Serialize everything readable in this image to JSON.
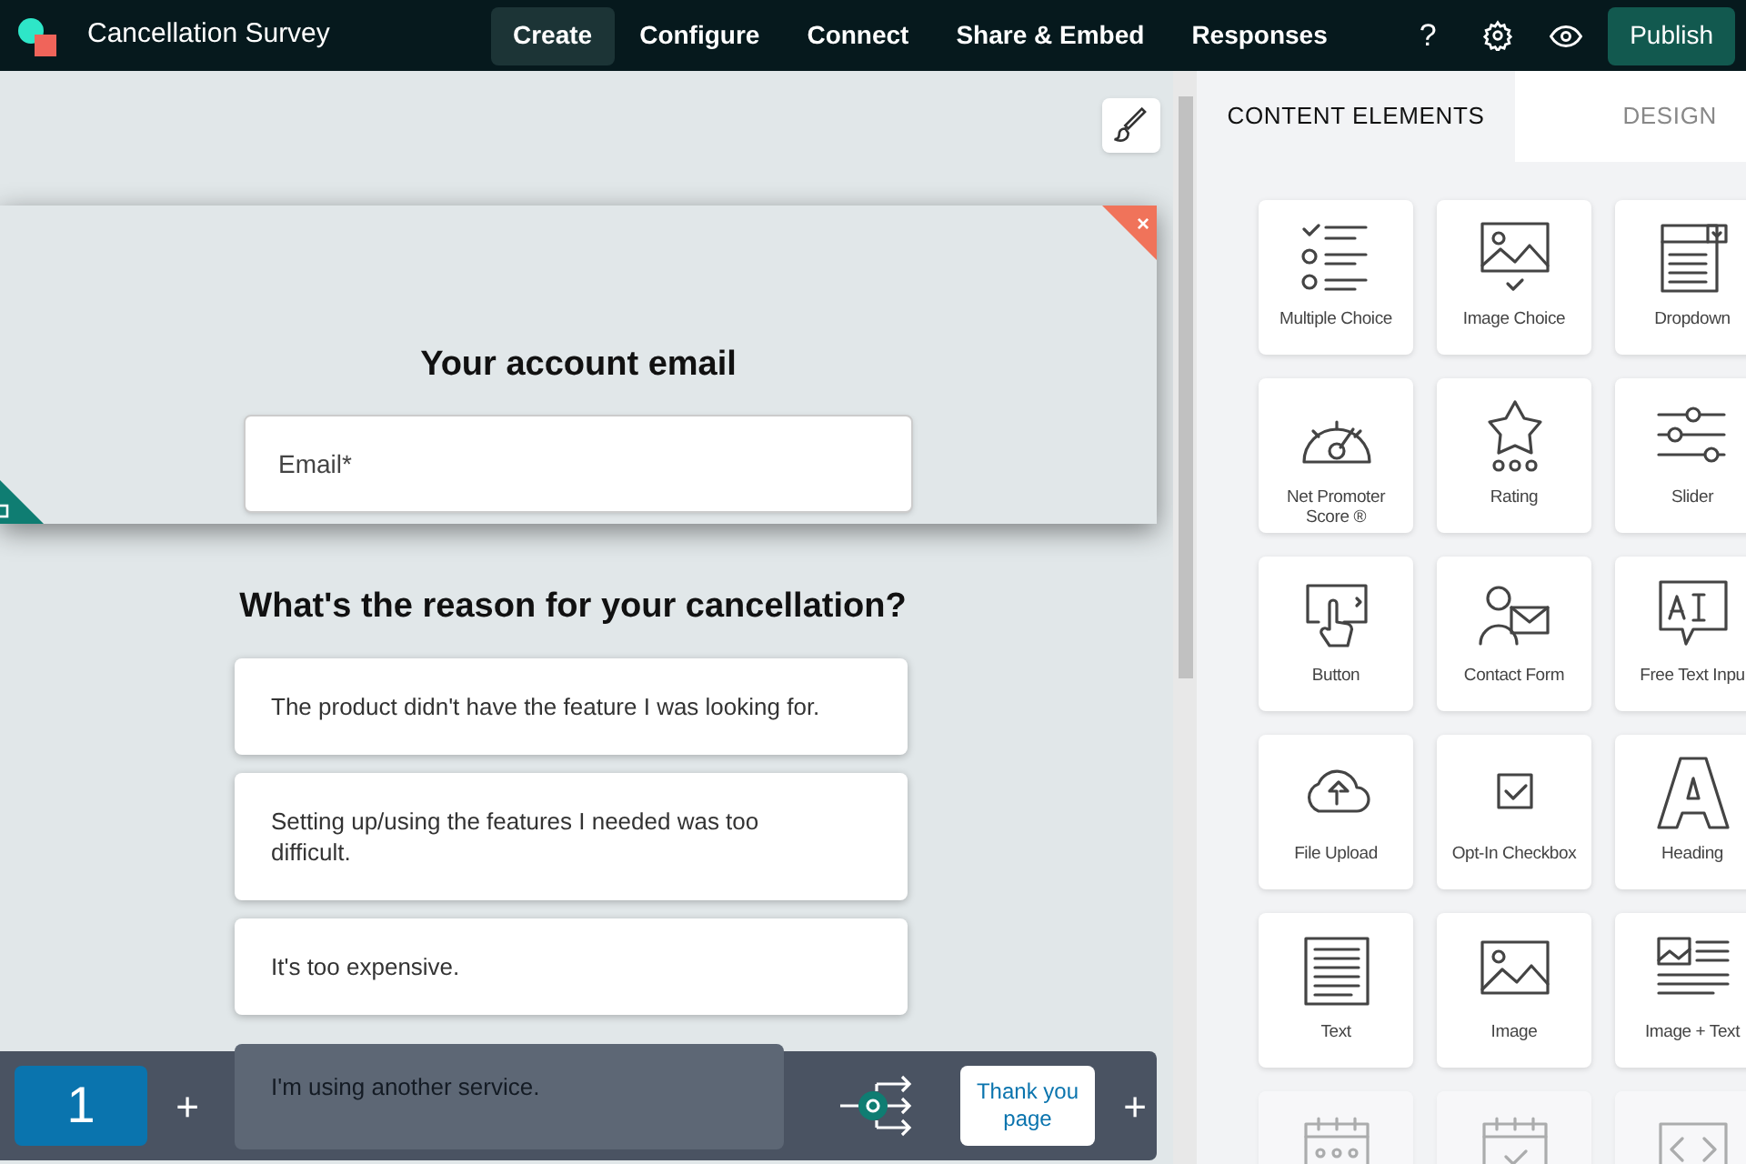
{
  "app": {
    "title": "Cancellation Survey"
  },
  "nav": [
    {
      "label": "Create",
      "selected": true
    },
    {
      "label": "Configure",
      "selected": false
    },
    {
      "label": "Connect",
      "selected": false
    },
    {
      "label": "Share & Embed",
      "selected": false
    },
    {
      "label": "Responses",
      "selected": false
    }
  ],
  "toolbar": {
    "help": "?",
    "publish": "Publish"
  },
  "canvas": {
    "close": "×",
    "email_heading": "Your account email",
    "email_placeholder": "Email*",
    "question": "What's the reason for your cancellation?",
    "options": [
      "The product didn't have the feature I was looking for.",
      "Setting up/using the features I needed was too difficult.",
      "It's too expensive.",
      "I'm using another service."
    ]
  },
  "pages": {
    "items": [
      {
        "label": "1",
        "selected": true
      }
    ],
    "add": "+",
    "thank_you": "Thank you page",
    "add_after": "+"
  },
  "panel": {
    "tabs": [
      {
        "label": "CONTENT ELEMENTS",
        "selected": true
      },
      {
        "label": "DESIGN",
        "selected": false
      }
    ],
    "elements": [
      {
        "kind": "choice",
        "label": "Multiple Choice"
      },
      {
        "kind": "imagechoice",
        "label": "Image Choice"
      },
      {
        "kind": "dropdown",
        "label": "Dropdown"
      },
      {
        "kind": "nps",
        "label": "Net Promoter Score ®"
      },
      {
        "kind": "rating",
        "label": "Rating"
      },
      {
        "kind": "slider",
        "label": "Slider"
      },
      {
        "kind": "button",
        "label": "Button"
      },
      {
        "kind": "contact",
        "label": "Contact Form"
      },
      {
        "kind": "textinput",
        "label": "Free Text Inpu"
      },
      {
        "kind": "upload",
        "label": "File Upload"
      },
      {
        "kind": "checkbox",
        "label": "Opt-In Checkbox"
      },
      {
        "kind": "heading",
        "label": "Heading"
      },
      {
        "kind": "text",
        "label": "Text"
      },
      {
        "kind": "image",
        "label": "Image"
      },
      {
        "kind": "imagetext",
        "label": "Image + Text"
      },
      {
        "kind": "date"
      },
      {
        "kind": "datecheck"
      },
      {
        "kind": "code"
      }
    ]
  }
}
